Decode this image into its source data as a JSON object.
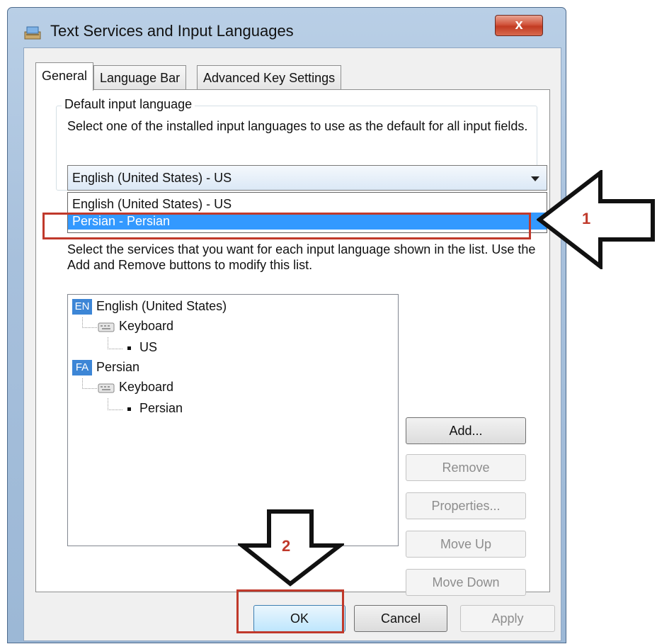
{
  "window": {
    "title": "Text Services and Input Languages",
    "close_label": "x"
  },
  "tabs": [
    {
      "label": "General",
      "active": true
    },
    {
      "label": "Language Bar",
      "active": false
    },
    {
      "label": "Advanced Key Settings",
      "active": false
    }
  ],
  "default_input": {
    "group_title": "Default input language",
    "description": "Select one of the installed input languages to use as the default for all input fields.",
    "selected": "English (United States) - US",
    "options": [
      "English (United States) - US",
      "Persian - Persian"
    ],
    "highlighted_option": "Persian - Persian"
  },
  "installed_services": {
    "description": "Select the services that you want for each input language shown in the list. Use the Add and Remove buttons to modify this list.",
    "tree": [
      {
        "tag": "EN",
        "language": "English (United States)",
        "group": "Keyboard",
        "layout": "US"
      },
      {
        "tag": "FA",
        "language": "Persian",
        "group": "Keyboard",
        "layout": "Persian"
      }
    ]
  },
  "side_buttons": {
    "add": "Add...",
    "remove": "Remove",
    "properties": "Properties...",
    "move_up": "Move Up",
    "move_down": "Move Down"
  },
  "bottom_buttons": {
    "ok": "OK",
    "cancel": "Cancel",
    "apply": "Apply"
  },
  "annotations": {
    "step1": "1",
    "step2": "2",
    "color": "#c0392b"
  },
  "colors": {
    "selection": "#3399ff",
    "lang_tag": "#3d86d6",
    "close_button": "#c23b22"
  }
}
